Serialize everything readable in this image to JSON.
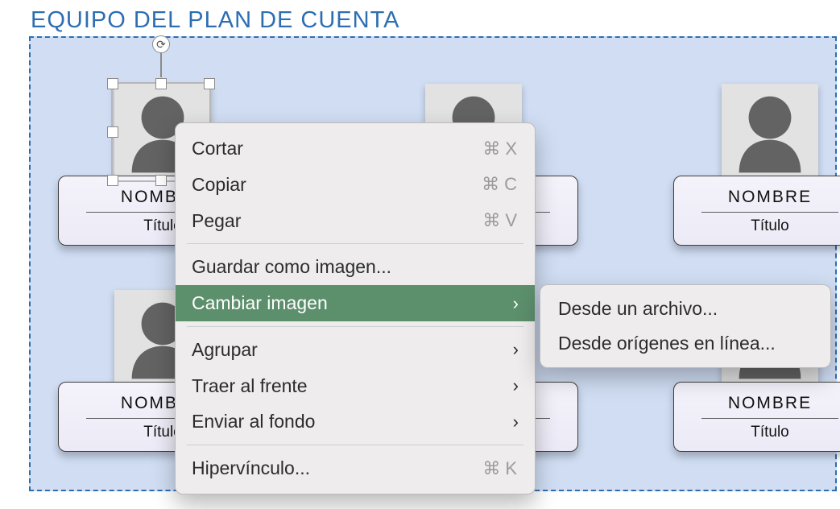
{
  "heading": "EQUIPO DEL PLAN DE CUENTA",
  "tile": {
    "name": "NOMBRE",
    "title": "Título"
  },
  "context_menu": {
    "cut": {
      "label": "Cortar",
      "shortcut_sym": "⌘",
      "shortcut_key": "X"
    },
    "copy": {
      "label": "Copiar",
      "shortcut_sym": "⌘",
      "shortcut_key": "C"
    },
    "paste": {
      "label": "Pegar",
      "shortcut_sym": "⌘",
      "shortcut_key": "V"
    },
    "save_as_image": "Guardar como imagen...",
    "change_image": "Cambiar imagen",
    "group": "Agrupar",
    "bring_front": "Traer al frente",
    "send_back": "Enviar al fondo",
    "hyperlink": {
      "label": "Hipervínculo...",
      "shortcut_sym": "⌘",
      "shortcut_key": "K"
    }
  },
  "submenu": {
    "from_file": "Desde un archivo...",
    "from_online": "Desde orígenes en línea..."
  },
  "icons": {
    "rotate": "⟳",
    "chevron": "›"
  }
}
